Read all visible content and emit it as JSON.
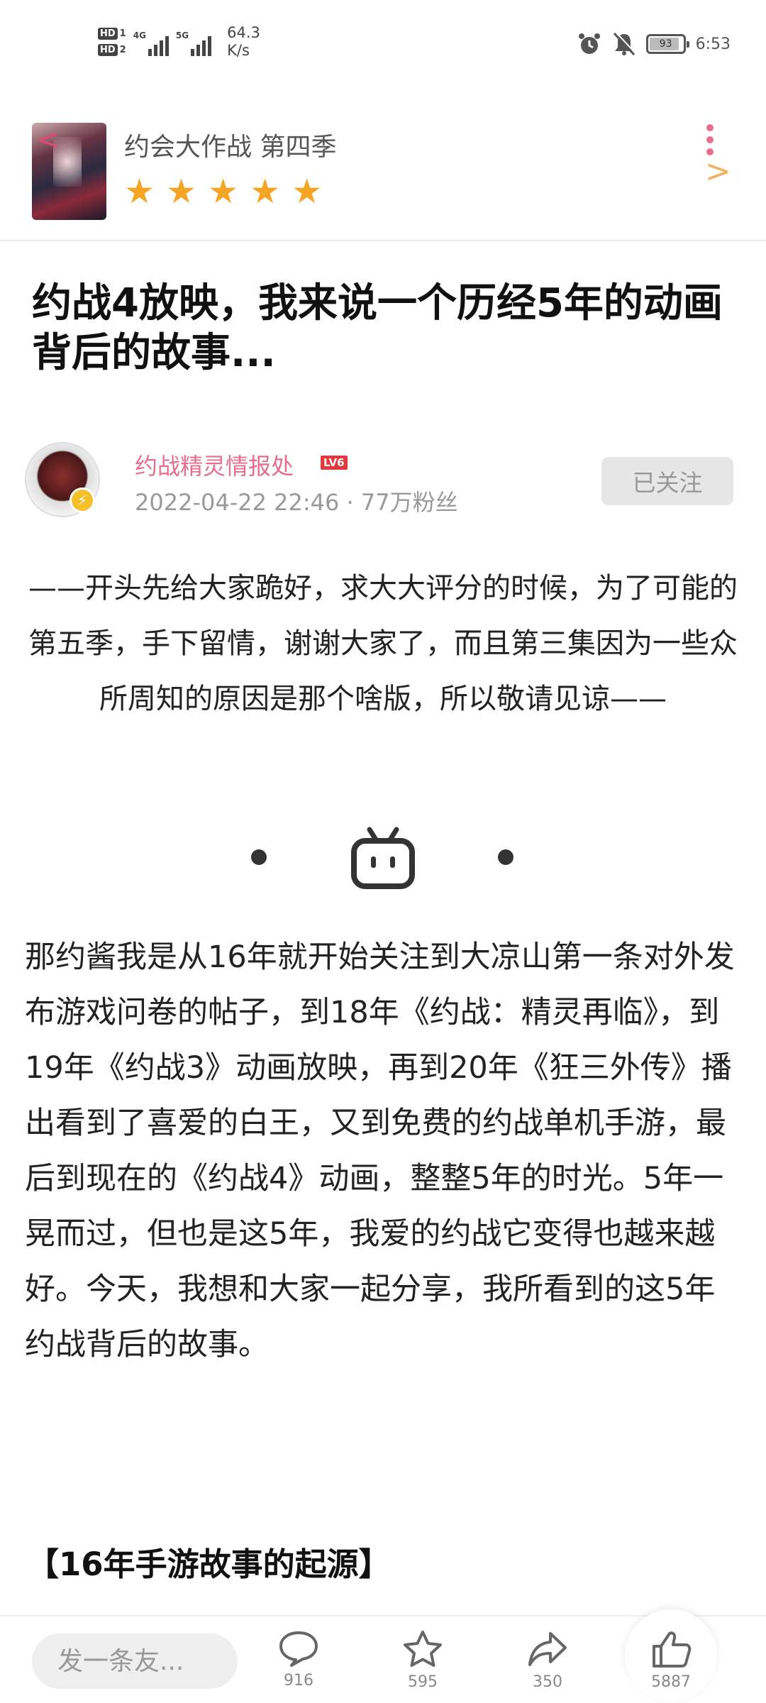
{
  "status_bar": {
    "sim1": "HD",
    "sim1_num": "1",
    "sim2": "HD",
    "sim2_num": "2",
    "net1": "4G",
    "net2": "5G",
    "speed_value": "64.3",
    "speed_unit": "K/s",
    "battery": "93",
    "battery_level": 0.93,
    "time": "6:53"
  },
  "header": {
    "anime_title": "约会大作战 第四季",
    "rating_stars": 5,
    "star_glyph": "★",
    "back_glyph": "<",
    "chevron_glyph": ">"
  },
  "article": {
    "title": "约战4放映，我来说一个历经5年的动画背后的故事...",
    "author": {
      "name": "约战精灵情报处",
      "level": "LV6",
      "date": "2022-04-22 22:46",
      "separator": "·",
      "fans": "77万粉丝",
      "follow_label": "已关注",
      "badge_glyph": "⚡"
    },
    "intro": "——开头先给大家跪好，求大大评分的时候，为了可能的第五季，手下留情，谢谢大家了，而且第三集因为一些众所周知的原因是那个啥版，所以敬请见谅——",
    "body": "那约酱我是从16年就开始关注到大凉山第一条对外发布游戏问卷的帖子，到18年《约战：精灵再临》，到19年《约战3》动画放映，再到20年《狂三外传》播出看到了喜爱的白王，又到免费的约战单机手游，最后到现在的《约战4》动画，整整5年的时光。5年一晃而过，但也是这5年，我爱的约战它变得也越来越好。今天，我想和大家一起分享，我所看到的这5年约战背后的故事。",
    "section_heading": "【16年手游故事的起源】"
  },
  "bottom_bar": {
    "comment_placeholder": "发一条友...",
    "comments": "916",
    "favorites": "595",
    "shares": "350",
    "likes": "5887"
  },
  "colors": {
    "accent_pink": "#e76c8e",
    "star": "#f5a524",
    "level_badge": "#e0393e"
  }
}
